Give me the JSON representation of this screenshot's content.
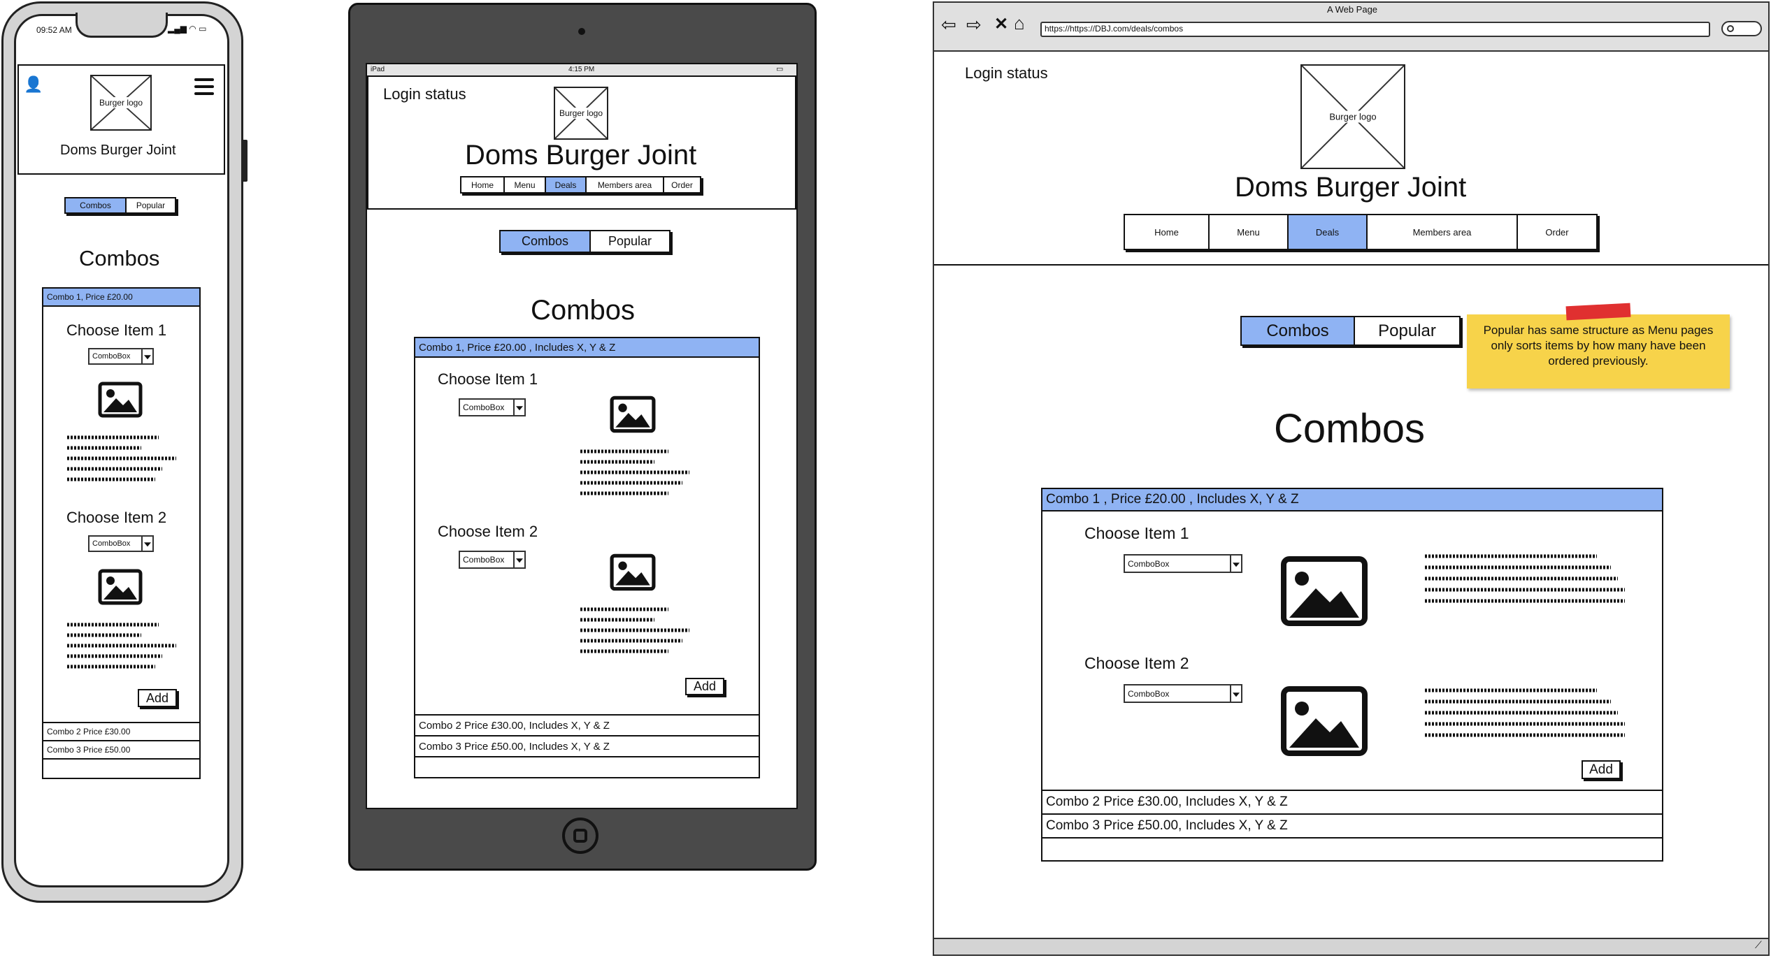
{
  "phone": {
    "status_time": "09:52 AM",
    "logo_label": "Burger logo",
    "title": "Doms Burger Joint",
    "tabs": [
      "Combos",
      "Popular"
    ],
    "heading": "Combos",
    "combo1_header": "Combo 1,  Price £20.00",
    "choose_item_1": "Choose Item 1",
    "choose_item_2": "Choose Item 2",
    "combobox": "ComboBox",
    "add": "Add",
    "combo2": "Combo 2    Price £30.00",
    "combo3": "Combo 3    Price £50.00"
  },
  "tablet": {
    "status_left": "iPad",
    "status_time": "4:15 PM",
    "login_status": "Login status",
    "logo_label": "Burger logo",
    "title": "Doms Burger Joint",
    "nav": [
      "Home",
      "Menu",
      "Deals",
      "Members area",
      "Order"
    ],
    "tabs": [
      "Combos",
      "Popular"
    ],
    "heading": "Combos",
    "combo1_header": "Combo 1,  Price £20.00 , Includes X, Y & Z",
    "choose_item_1": "Choose Item 1",
    "choose_item_2": "Choose Item 2",
    "combobox": "ComboBox",
    "add": "Add",
    "combo2": "Combo 2    Price £30.00, Includes X, Y & Z",
    "combo3": "Combo 3    Price £50.00, Includes X, Y & Z"
  },
  "browser": {
    "window_title": "A Web Page",
    "url": "https://https://DBJ.com/deals/combos",
    "login_status": "Login status",
    "logo_label": "Burger logo",
    "title": "Doms Burger Joint",
    "nav": [
      "Home",
      "Menu",
      "Deals",
      "Members area",
      "Order"
    ],
    "tabs": [
      "Combos",
      "Popular"
    ],
    "note": "Popular has same structure as Menu pages only sorts items by how many have been ordered previously.",
    "heading": "Combos",
    "combo1_header": "Combo 1 ,   Price £20.00 , Includes X, Y & Z",
    "choose_item_1": "Choose Item 1",
    "choose_item_2": "Choose Item 2",
    "combobox": "ComboBox",
    "add": "Add",
    "combo2": "Combo 2    Price £30.00, Includes X, Y & Z",
    "combo3": "Combo 3    Price £50.00, Includes X, Y & Z"
  },
  "colors": {
    "accent_blue": "#8fb3f3",
    "note_yellow": "#f7d34a",
    "tape_red": "#e03030",
    "device_dark": "#4a4a4a",
    "device_light": "#d8d8d8"
  }
}
